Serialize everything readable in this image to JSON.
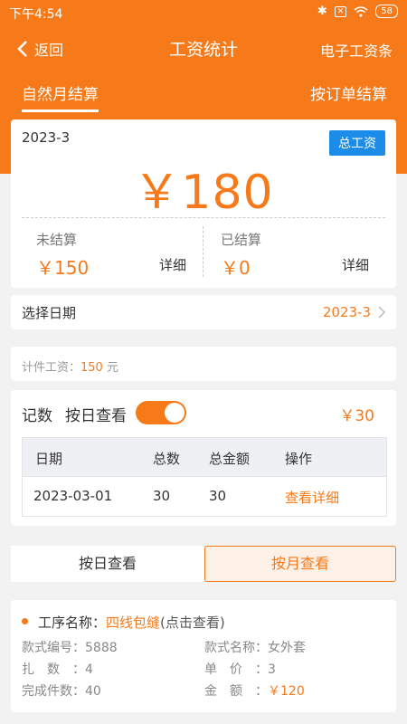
{
  "status_bar": {
    "time": "下午4:54",
    "battery": "58"
  },
  "nav": {
    "back_label": "返回",
    "title": "工资统计",
    "right_label": "电子工资条"
  },
  "tabs": {
    "natural_month": "自然月结算",
    "by_order": "按订单结算"
  },
  "summary": {
    "month": "2023-3",
    "badge": "总工资",
    "total": "￥180",
    "unsettled_label": "未结算",
    "unsettled_amount": "￥150",
    "unsettled_detail": "详细",
    "settled_label": "已结算",
    "settled_amount": "￥0",
    "settled_detail": "详细"
  },
  "date_select": {
    "label": "选择日期",
    "value": "2023-3"
  },
  "piece_wage": {
    "label": "计件工资：",
    "value": "150",
    "unit": " 元"
  },
  "count": {
    "title": "记数",
    "toggle_label": "按日查看",
    "toggle_on": true,
    "amount": "￥30",
    "table": {
      "headers": [
        "日期",
        "总数",
        "总金额",
        "操作"
      ],
      "rows": [
        {
          "date": "2023-03-01",
          "total": "30",
          "total_amount": "30",
          "action": "查看详细"
        }
      ]
    }
  },
  "segment": {
    "by_day": "按日查看",
    "by_month": "按月查看",
    "selected": "by_month"
  },
  "process": {
    "name_label": "工序名称：",
    "name_value": "四线包缝",
    "name_hint": "(点击查看)",
    "style_no_label": "款式编号：",
    "style_no": "5888",
    "style_name_label": "款式名称：",
    "style_name": "女外套",
    "bundle_label": "扎　数　：",
    "bundle": "4",
    "unit_price_label": "单　价　：",
    "unit_price": "3",
    "completed_label": "完成件数：",
    "completed": "40",
    "amount_label": "金　额　：",
    "amount": "￥120"
  },
  "colors": {
    "accent": "#f77a1a",
    "badge": "#1b8de9"
  }
}
